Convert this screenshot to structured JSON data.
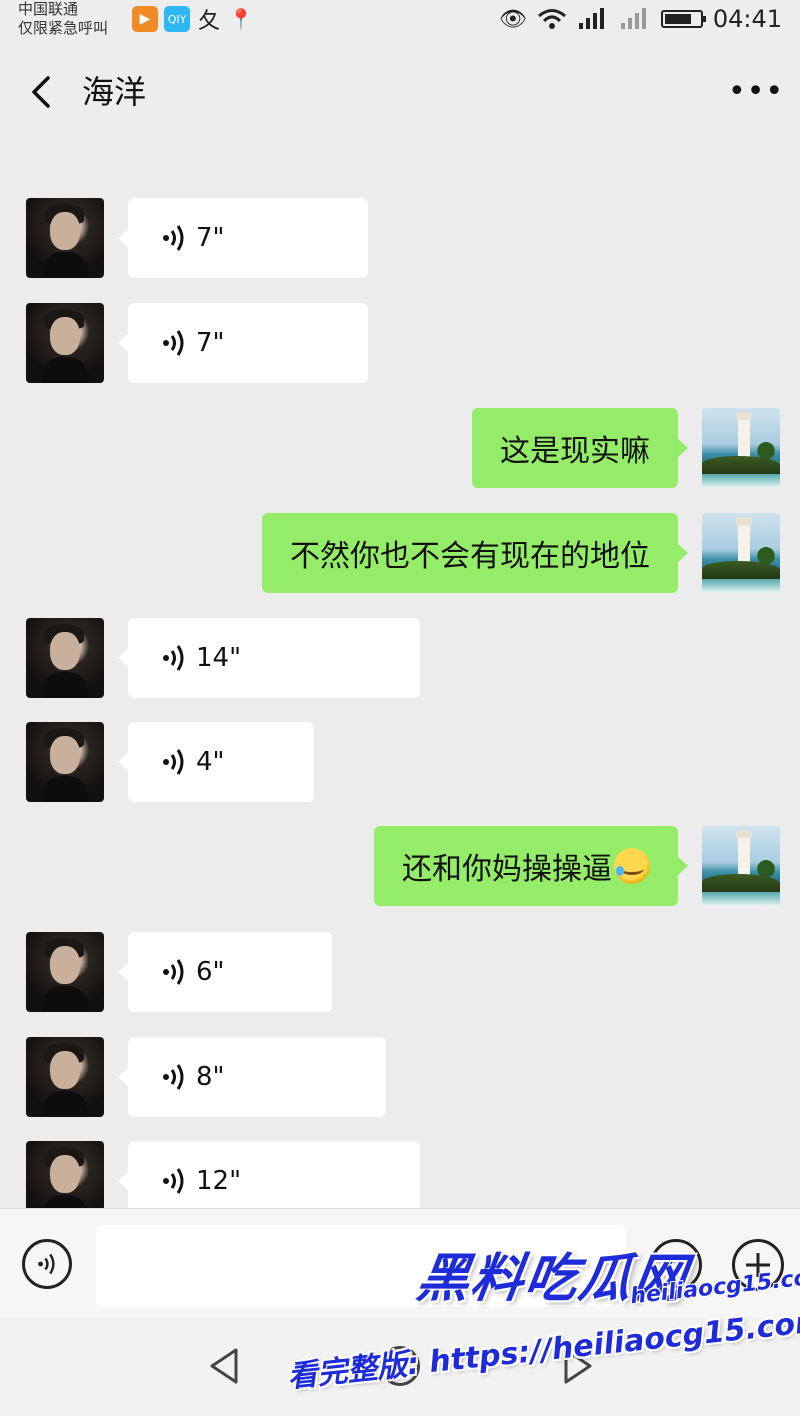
{
  "status_bar": {
    "carrier_line1": "中国联通",
    "carrier_line2": "仅限紧急呼叫",
    "notification_icons": [
      "video-app-icon",
      "iqiyi-icon",
      "app-icon",
      "location-icon"
    ],
    "time": "04:41"
  },
  "header": {
    "title": "海洋",
    "more_label": "•••"
  },
  "messages": [
    {
      "side": "left",
      "type": "voice",
      "duration": "7\""
    },
    {
      "side": "left",
      "type": "voice",
      "duration": "7\""
    },
    {
      "side": "right",
      "type": "text",
      "text": "这是现实嘛"
    },
    {
      "side": "right",
      "type": "text",
      "text": "不然你也不会有现在的地位"
    },
    {
      "side": "left",
      "type": "voice",
      "duration": "14\""
    },
    {
      "side": "left",
      "type": "voice",
      "duration": "4\""
    },
    {
      "side": "right",
      "type": "text",
      "text": "还和你妈操操逼"
    },
    {
      "side": "left",
      "type": "voice",
      "duration": "6\""
    },
    {
      "side": "left",
      "type": "voice",
      "duration": "8\""
    },
    {
      "side": "left",
      "type": "voice",
      "duration": "12\""
    }
  ],
  "input_bar": {
    "input_value": ""
  },
  "watermark": {
    "logo": "黑料吃瓜网",
    "url": "heiliaocg15.com",
    "full": "看完整版: https://heiliaocg15.com"
  },
  "colors": {
    "background": "#ececec",
    "incoming_bubble": "#ffffff",
    "outgoing_bubble": "#95ec69",
    "watermark": "#1e2bd8"
  }
}
